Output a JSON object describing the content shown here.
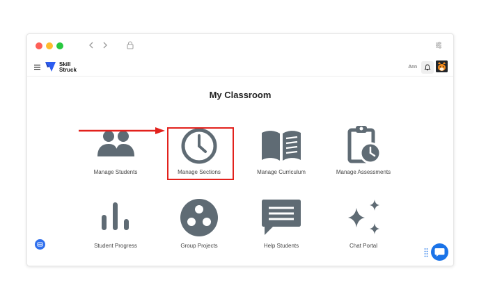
{
  "app": {
    "logo_line1": "Skill",
    "logo_line2": "Struck",
    "user_name": "Ann"
  },
  "page": {
    "title": "My Classroom"
  },
  "tiles": [
    {
      "label": "Manage Students",
      "icon": "students-icon"
    },
    {
      "label": "Manage Sections",
      "icon": "clock-icon"
    },
    {
      "label": "Manage Curriculum",
      "icon": "book-icon"
    },
    {
      "label": "Manage Assessments",
      "icon": "clipboard-clock-icon"
    },
    {
      "label": "Student Progress",
      "icon": "bar-chart-icon"
    },
    {
      "label": "Group Projects",
      "icon": "group-circle-icon"
    },
    {
      "label": "Help Students",
      "icon": "chat-bubble-icon"
    },
    {
      "label": "Chat Portal",
      "icon": "sparkles-icon"
    }
  ],
  "colors": {
    "icon_gray": "#5f6b74",
    "highlight_red": "#e2211c",
    "accent_blue": "#1a73e8",
    "logo_blue": "#2b5cf0"
  }
}
